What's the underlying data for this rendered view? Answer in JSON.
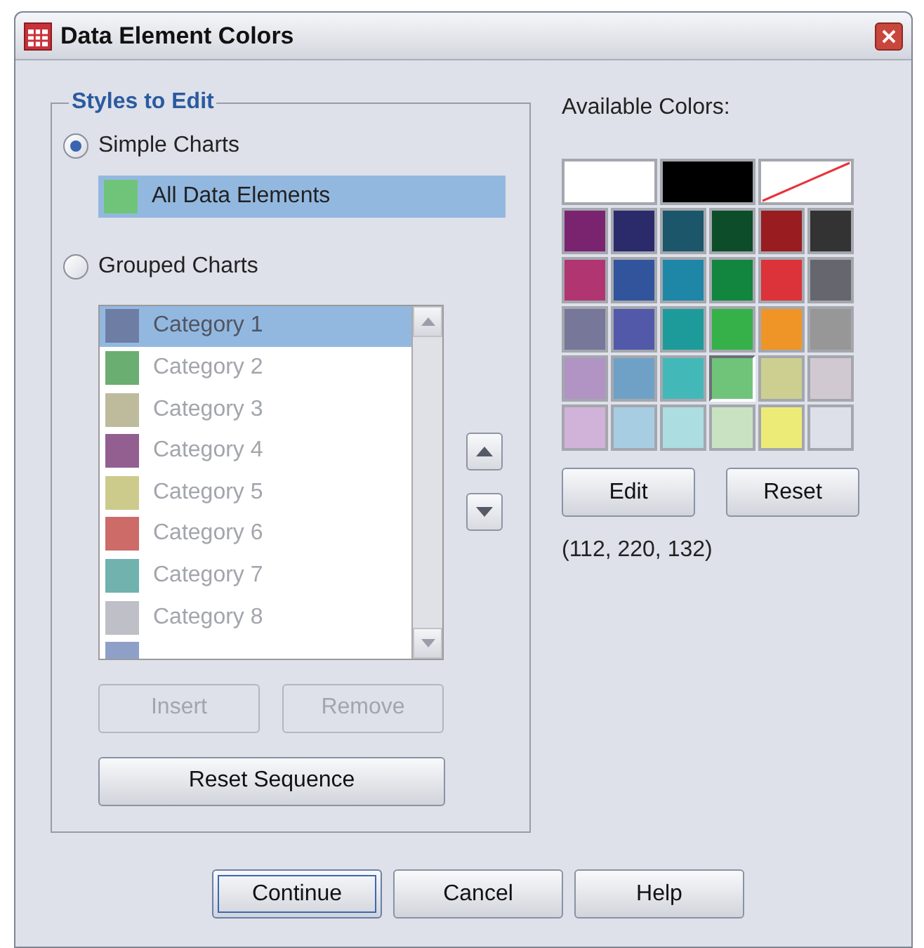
{
  "window": {
    "title": "Data Element Colors"
  },
  "styles_group": {
    "title": "Styles to Edit",
    "simple": {
      "label": "Simple Charts",
      "selected": true,
      "items": [
        {
          "label": "All Data Elements",
          "color": "#70c47a",
          "selected": true
        }
      ]
    },
    "grouped": {
      "label": "Grouped Charts",
      "selected": false,
      "disabled": true,
      "items": [
        {
          "label": "Category 1",
          "color": "#6e7da4",
          "selected": true
        },
        {
          "label": "Category 2",
          "color": "#6aae72",
          "selected": false
        },
        {
          "label": "Category 3",
          "color": "#bdbb9c",
          "selected": false
        },
        {
          "label": "Category 4",
          "color": "#925f90",
          "selected": false
        },
        {
          "label": "Category 5",
          "color": "#cccb8c",
          "selected": false
        },
        {
          "label": "Category 6",
          "color": "#cd6b68",
          "selected": false
        },
        {
          "label": "Category 7",
          "color": "#71b2ae",
          "selected": false
        },
        {
          "label": "Category 8",
          "color": "#bfbfc7",
          "selected": false
        },
        {
          "color": "#8fa0c8",
          "selected": false
        }
      ]
    },
    "buttons": [
      {
        "label": "Insert",
        "disabled": true
      },
      {
        "label": "Remove",
        "disabled": true
      },
      {
        "label": "Reset Sequence",
        "disabled": false
      }
    ]
  },
  "palette": {
    "title": "Available Colors:",
    "special": [
      {
        "kind": "color",
        "color": "#ffffff",
        "selected": false
      },
      {
        "kind": "color",
        "color": "#000000",
        "selected": false
      },
      {
        "kind": "none",
        "selected": false
      }
    ],
    "rows": [
      [
        {
          "color": "#7a2470",
          "selected": false
        },
        {
          "color": "#2b2a6b",
          "selected": false
        },
        {
          "color": "#1c566b",
          "selected": false
        },
        {
          "color": "#0e4d2a",
          "selected": false
        },
        {
          "color": "#981c20",
          "selected": false
        },
        {
          "color": "#333333",
          "selected": false
        }
      ],
      [
        {
          "color": "#b03571",
          "selected": false
        },
        {
          "color": "#32549c",
          "selected": false
        },
        {
          "color": "#1e86a6",
          "selected": false
        },
        {
          "color": "#12853e",
          "selected": false
        },
        {
          "color": "#dc3239",
          "selected": false
        },
        {
          "color": "#65666e",
          "selected": false
        }
      ],
      [
        {
          "color": "#767799",
          "selected": false
        },
        {
          "color": "#5159a8",
          "selected": false
        },
        {
          "color": "#1d9b9a",
          "selected": false
        },
        {
          "color": "#36b14a",
          "selected": false
        },
        {
          "color": "#ef9527",
          "selected": false
        },
        {
          "color": "#979797",
          "selected": false
        }
      ],
      [
        {
          "color": "#b193c4",
          "selected": false
        },
        {
          "color": "#6fa1c7",
          "selected": false
        },
        {
          "color": "#42b9b8",
          "selected": false
        },
        {
          "color": "#70c47a",
          "selected": true
        },
        {
          "color": "#cccf90",
          "selected": false
        },
        {
          "color": "#d1c9d2",
          "selected": false
        }
      ],
      [
        {
          "color": "#d1b2d8",
          "selected": false
        },
        {
          "color": "#a7cde3",
          "selected": false
        },
        {
          "color": "#acdde0",
          "selected": false
        },
        {
          "color": "#c9e3c2",
          "selected": false
        },
        {
          "color": "#eceb78",
          "selected": false
        },
        {
          "color": "#dde0e8",
          "selected": false
        }
      ]
    ],
    "buttons": [
      {
        "label": "Edit"
      },
      {
        "label": "Reset"
      }
    ],
    "rgb": "(112, 220, 132)"
  },
  "footer_buttons": [
    {
      "label": "Continue",
      "default": true
    },
    {
      "label": "Cancel",
      "default": false
    },
    {
      "label": "Help",
      "default": false
    }
  ]
}
